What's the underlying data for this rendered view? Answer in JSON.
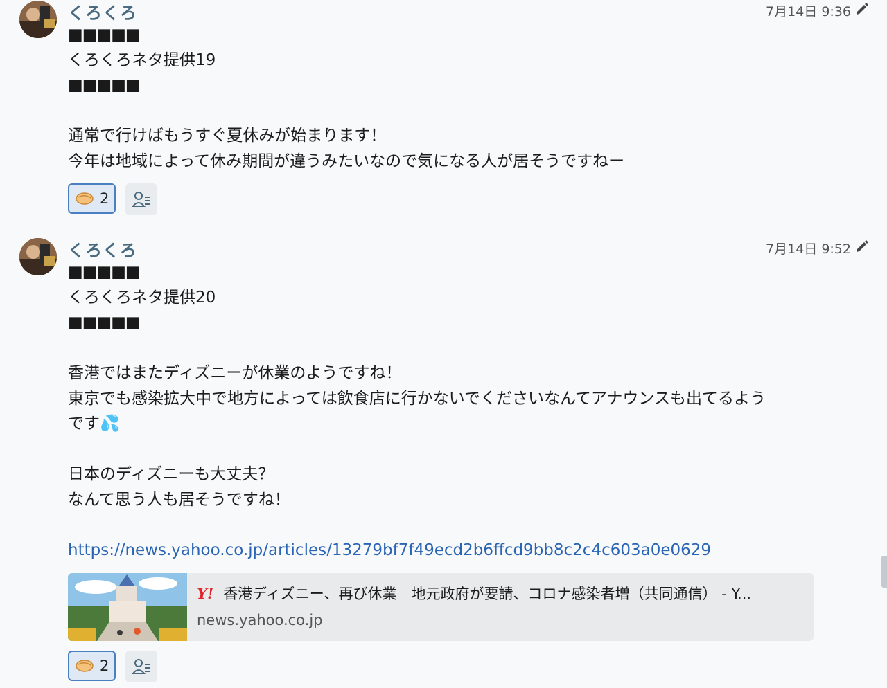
{
  "messages": [
    {
      "author": "くろくろ",
      "timestamp": "7月14日 9:36",
      "redacted": "■■■■■",
      "title": "くろくろネタ提供19",
      "lines": [
        "通常で行けばもうすぐ夏休みが始まります！",
        "今年は地域によって休み期間が違うみたいなので気になる人が居そうですねー"
      ],
      "reaction": {
        "icon": "handshake-emoji",
        "count": "2"
      }
    },
    {
      "author": "くろくろ",
      "timestamp": "7月14日 9:52",
      "redacted": "■■■■■",
      "title": "くろくろネタ提供20",
      "lines": [
        "香港ではまたディズニーが休業のようですね！",
        "東京でも感染拡大中で地方によっては飲食店に行かないでくださいなんてアナウンスも出てるよう",
        "です💦",
        "",
        "日本のディズニーも大丈夫？",
        "なんて思う人も居そうですね！"
      ],
      "link": "https://news.yahoo.co.jp/articles/13279bf7f49ecd2b6ffcd9bb8c2c4c603a0e0629",
      "preview": {
        "logo": "Y!",
        "title": "香港ディズニー、再び休業　地元政府が要請、コロナ感染者増（共同通信） - Y...",
        "domain": "news.yahoo.co.jp"
      },
      "reaction": {
        "icon": "handshake-emoji",
        "count": "2"
      }
    }
  ],
  "colors": {
    "author": "#4a6a80",
    "link": "#2a64b5",
    "reaction_border": "#4a7fc1"
  }
}
